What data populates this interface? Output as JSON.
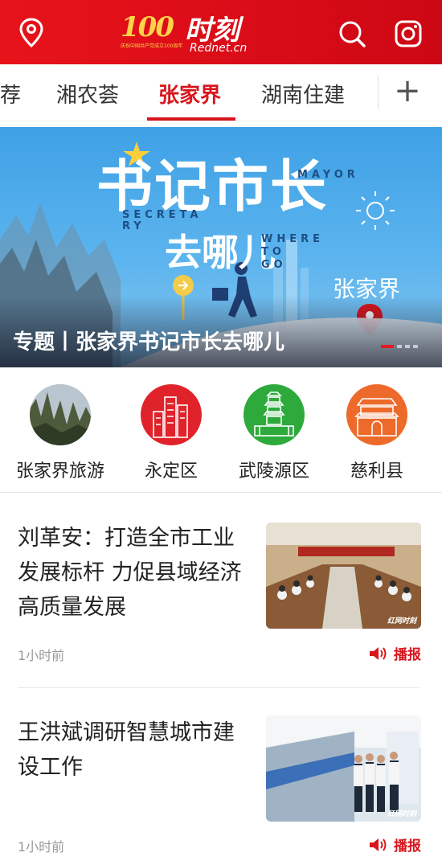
{
  "header": {
    "logo_badge": "100",
    "logo_badge_caption": "庆祝中国共产党成立100周年",
    "logo_name": "时刻",
    "logo_url": "Rednet.cn",
    "icons": [
      "location-pin-icon",
      "search-icon",
      "camera-icon"
    ]
  },
  "tabs": {
    "items": [
      "荐",
      "湘农荟",
      "张家界",
      "湖南住建"
    ],
    "active": "张家界",
    "add_label": "+"
  },
  "banner": {
    "poster_title_1": "书记市长",
    "poster_title_2": "去哪儿",
    "en_mayor": "MAYOR",
    "en_secretary_1": "SECRETA",
    "en_secretary_2": "RY",
    "en_where_1": "WHERE",
    "en_where_2": "TO",
    "en_where_3": "GO",
    "place_label": "张家界",
    "caption": "专题丨张家界书记市长去哪儿",
    "slide_count": 4,
    "active_slide": 1
  },
  "channels": [
    {
      "label": "张家界旅游",
      "color": "#5a6a4a",
      "icon": "mountain-photo"
    },
    {
      "label": "永定区",
      "color": "#e0232b",
      "icon": "buildings-icon"
    },
    {
      "label": "武陵源区",
      "color": "#2daa3b",
      "icon": "pagoda-icon"
    },
    {
      "label": "慈利县",
      "color": "#ee6a2a",
      "icon": "gate-tower-icon"
    }
  ],
  "news": [
    {
      "title": "刘革安：打造全市工业发展标杆 力促县域经济高质量发展",
      "time": "1小时前",
      "play_label": "播报",
      "thumb_watermark": "红网时刻"
    },
    {
      "title": "王洪斌调研智慧城市建设工作",
      "time": "1小时前",
      "play_label": "播报",
      "thumb_watermark": "红网时刻"
    }
  ],
  "colors": {
    "brand_red": "#d9151d",
    "header_red": "#e8131a",
    "banner_blue": "#3fa1e6"
  }
}
